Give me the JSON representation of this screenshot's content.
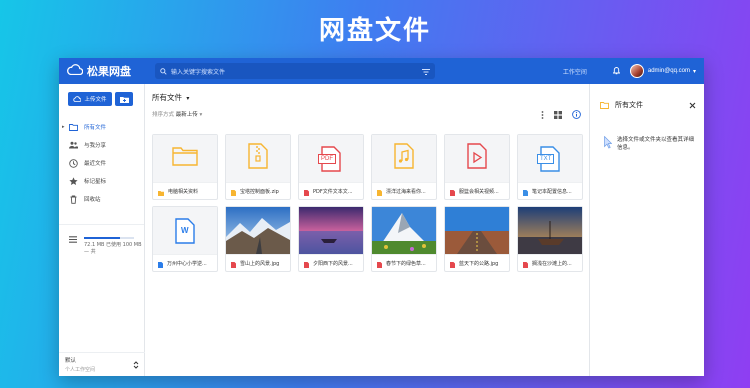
{
  "banner": {
    "title": "网盘文件"
  },
  "topbar": {
    "logo_text": "松果网盘",
    "search_placeholder": "输入关键字搜索文件",
    "workspace_label": "工作空间",
    "user_email": "admin@qq.com"
  },
  "sidebar": {
    "upload_label": "上传文件",
    "items": [
      {
        "label": "所有文件",
        "icon": "folder-icon"
      },
      {
        "label": "与我分享",
        "icon": "people-icon"
      },
      {
        "label": "最近文件",
        "icon": "clock-icon"
      },
      {
        "label": "标记星标",
        "icon": "star-icon"
      },
      {
        "label": "回收站",
        "icon": "trash-icon"
      }
    ],
    "storage_text": "72.1 MB 已使用 100 MB — 共",
    "storage_used_fraction": 0.72,
    "workspace_name": "默认",
    "workspace_sub": "个人工作空间"
  },
  "main": {
    "breadcrumb": "所有文件",
    "sort_prefix": "排序方式",
    "sort_value": "最新上传",
    "files": [
      {
        "name": "电脑相关资料",
        "kind": "folder"
      },
      {
        "name": "宝塔控制面板.zip",
        "kind": "zip"
      },
      {
        "name": "PDF文件文本文...",
        "kind": "pdf"
      },
      {
        "name": "漂洋过海来看你...",
        "kind": "music"
      },
      {
        "name": "服篮会相关视频...",
        "kind": "video"
      },
      {
        "name": "笔记本配置信息...",
        "kind": "txt"
      },
      {
        "name": "万州中心小学逆...",
        "kind": "word"
      },
      {
        "name": "雪山上的风景.jpg",
        "kind": "img-mountain"
      },
      {
        "name": "夕阳西下的风景...",
        "kind": "img-sunset"
      },
      {
        "name": "春节下的绿色草...",
        "kind": "img-matterhorn"
      },
      {
        "name": "蓝天下的公路.jpg",
        "kind": "img-road"
      },
      {
        "name": "搁浅在沙滩上的...",
        "kind": "img-boat"
      }
    ],
    "badges": {
      "pdf": "PDF",
      "txt": "TXT",
      "word": "W"
    }
  },
  "details": {
    "title": "所有文件",
    "hint": "选择文件或文件夹以查看其详细信息。"
  },
  "colors": {
    "primary": "#1f63d6",
    "folder": "#f7b531",
    "pdf": "#e5484d",
    "txt": "#3a8ee6",
    "word": "#2b7de9"
  }
}
